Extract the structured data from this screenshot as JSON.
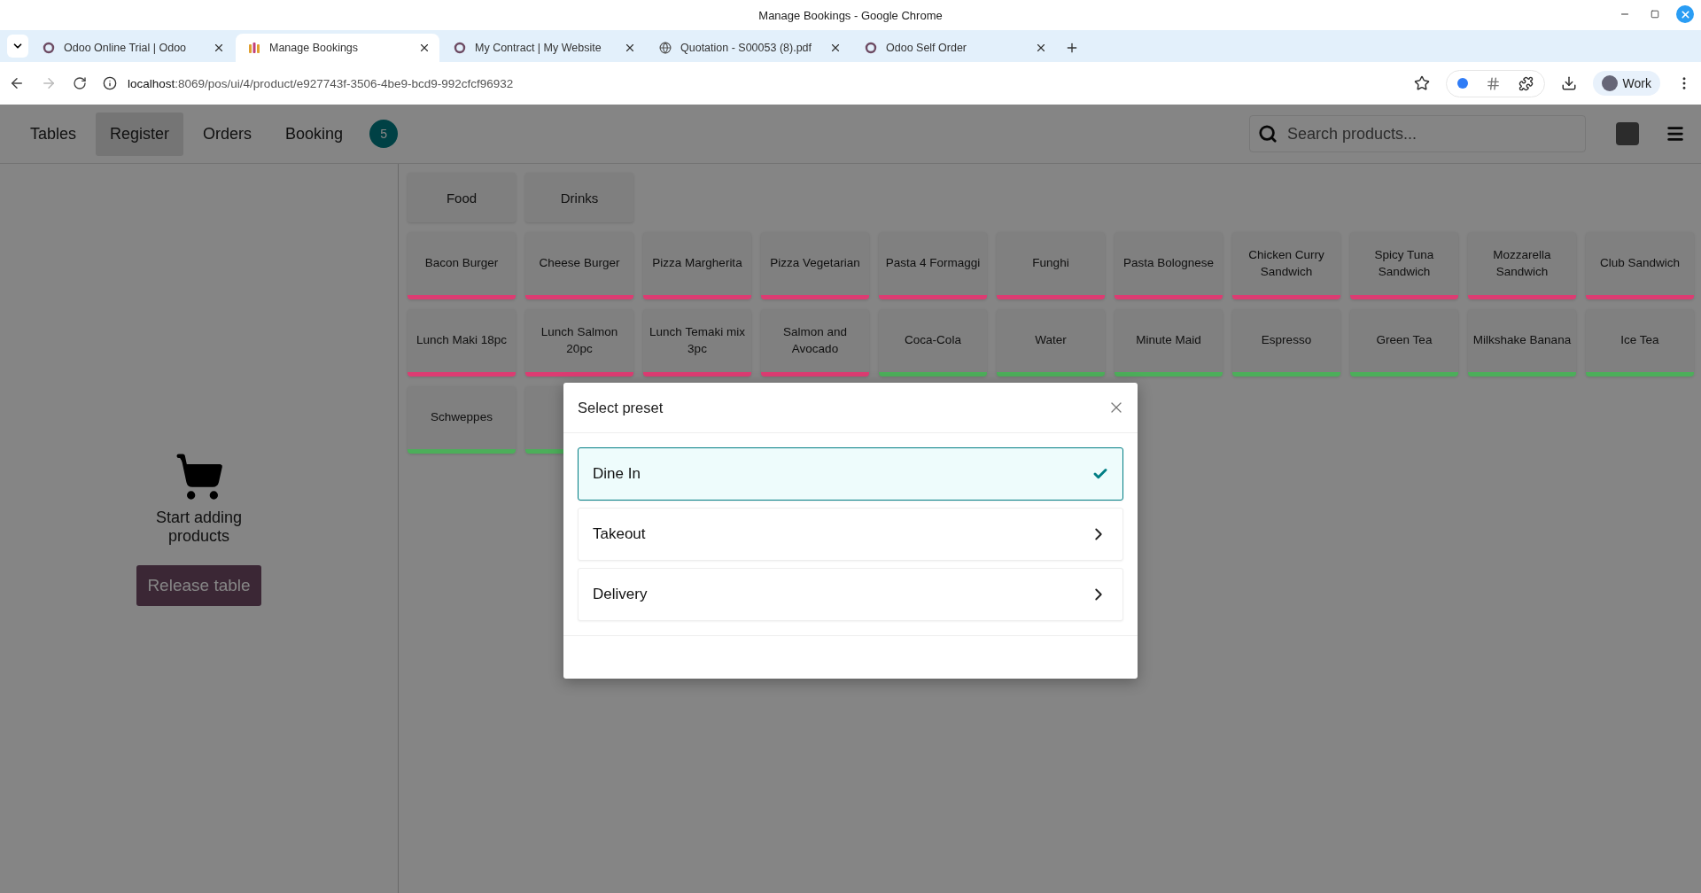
{
  "window": {
    "title": "Manage Bookings - Google Chrome"
  },
  "browser_tabs": [
    {
      "title": "Odoo Online Trial | Odoo",
      "kind": "ring",
      "selected": false
    },
    {
      "title": "Manage Bookings",
      "kind": "bookings",
      "selected": true
    },
    {
      "title": "My Contract | My Website",
      "kind": "ring",
      "selected": false
    },
    {
      "title": "Quotation - S00053 (8).pdf",
      "kind": "globe",
      "selected": false
    },
    {
      "title": "Odoo Self Order",
      "kind": "ring",
      "selected": false
    }
  ],
  "address_bar": {
    "host": "localhost",
    "path": ":8069/pos/ui/4/product/e927743f-3506-4be9-bcd9-992cfcf96932"
  },
  "profile": {
    "label": "Work"
  },
  "nav": [
    {
      "label": "Tables",
      "selected": false
    },
    {
      "label": "Register",
      "selected": true
    },
    {
      "label": "Orders",
      "selected": false
    },
    {
      "label": "Booking",
      "selected": false
    }
  ],
  "booking_badge": "5",
  "search": {
    "placeholder": "Search products..."
  },
  "categories": [
    "Food",
    "Drinks"
  ],
  "products": [
    {
      "name": "Bacon Burger",
      "color": "#dc3c72"
    },
    {
      "name": "Cheese Burger",
      "color": "#dc3c72"
    },
    {
      "name": "Pizza Margherita",
      "color": "#dc3c72"
    },
    {
      "name": "Pizza Vegetarian",
      "color": "#dc3c72"
    },
    {
      "name": "Pasta 4 Formaggi",
      "color": "#dc3c72"
    },
    {
      "name": "Funghi",
      "color": "#dc3c72"
    },
    {
      "name": "Pasta Bolognese",
      "color": "#dc3c72"
    },
    {
      "name": "Chicken Curry Sandwich",
      "color": "#dc3c72"
    },
    {
      "name": "Spicy Tuna Sandwich",
      "color": "#dc3c72"
    },
    {
      "name": "Mozzarella Sandwich",
      "color": "#dc3c72"
    },
    {
      "name": "Club Sandwich",
      "color": "#dc3c72"
    },
    {
      "name": "Lunch Maki 18pc",
      "color": "#dc3c72"
    },
    {
      "name": "Lunch Salmon 20pc",
      "color": "#dc3c72"
    },
    {
      "name": "Lunch Temaki mix 3pc",
      "color": "#dc3c72"
    },
    {
      "name": "Salmon and Avocado",
      "color": "#dc3c72"
    },
    {
      "name": "Coca-Cola",
      "color": "#4cae5a"
    },
    {
      "name": "Water",
      "color": "#4cae5a"
    },
    {
      "name": "Minute Maid",
      "color": "#4cae5a"
    },
    {
      "name": "Espresso",
      "color": "#4cae5a"
    },
    {
      "name": "Green Tea",
      "color": "#4cae5a"
    },
    {
      "name": "Milkshake Banana",
      "color": "#4cae5a"
    },
    {
      "name": "Ice Tea",
      "color": "#4cae5a"
    },
    {
      "name": "Schweppes",
      "color": "#4cae5a"
    },
    {
      "color": "#4cae5a"
    }
  ],
  "order": {
    "empty_text": "Start adding products",
    "button": "Release table"
  },
  "dialog": {
    "title": "Select preset",
    "presets": [
      {
        "label": "Dine In",
        "selected": true
      },
      {
        "label": "Takeout",
        "selected": false
      },
      {
        "label": "Delivery",
        "selected": false
      }
    ]
  }
}
